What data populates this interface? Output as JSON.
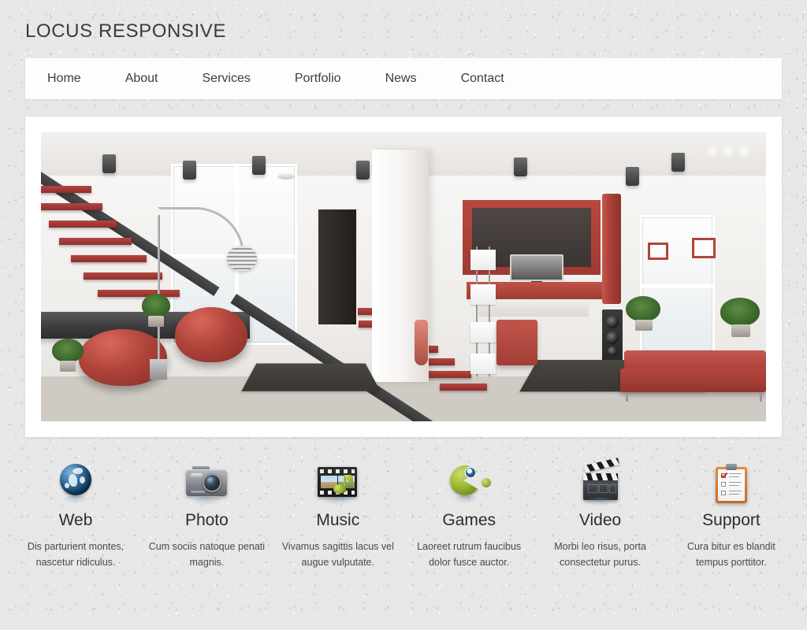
{
  "site": {
    "logo": "LOCUS RESPONSIVE"
  },
  "nav": {
    "items": [
      {
        "label": "Home"
      },
      {
        "label": "About"
      },
      {
        "label": "Services"
      },
      {
        "label": "Portfolio"
      },
      {
        "label": "News"
      },
      {
        "label": "Contact"
      }
    ]
  },
  "slider": {
    "dots": [
      {
        "name": "slide-1",
        "active": false
      },
      {
        "name": "slide-2",
        "active": false
      },
      {
        "name": "slide-3",
        "active": false
      }
    ],
    "image_alt": "Modern red and white interior living room with floating staircase"
  },
  "features": [
    {
      "icon": "globe-icon",
      "title": "Web",
      "desc": "Dis parturient montes, nascetur ridiculus."
    },
    {
      "icon": "camera-icon",
      "title": "Photo",
      "desc": "Cum sociis natoque penati magnis."
    },
    {
      "icon": "film-music-icon",
      "title": "Music",
      "desc": "Vivamus sagittis lacus vel augue vulputate."
    },
    {
      "icon": "pacman-icon",
      "title": "Games",
      "desc": "Laoreet rutrum faucibus dolor fusce auctor."
    },
    {
      "icon": "clapperboard-icon",
      "title": "Video",
      "desc": "Morbi leo risus, porta consectetur purus."
    },
    {
      "icon": "clipboard-icon",
      "title": "Support",
      "desc": "Cura bitur es blandit tempus porttitor."
    }
  ],
  "colors": {
    "page_background": "#e7e7e7",
    "panel": "#ffffff",
    "text": "#3b3b3b",
    "accent_red": "#b0443b"
  }
}
